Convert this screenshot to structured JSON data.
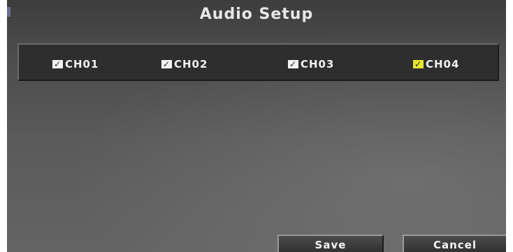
{
  "dialog": {
    "title": "Audio Setup"
  },
  "channels": [
    {
      "label": "CH01",
      "checked": true,
      "check_color": "#f2f2f2"
    },
    {
      "label": "CH02",
      "checked": true,
      "check_color": "#f2f2f2"
    },
    {
      "label": "CH03",
      "checked": true,
      "check_color": "#f2f2f2"
    },
    {
      "label": "CH04",
      "checked": true,
      "check_color": "#e6e632"
    }
  ],
  "buttons": {
    "save": "Save",
    "cancel": "Cancel"
  },
  "icons": {
    "check": "✓"
  }
}
